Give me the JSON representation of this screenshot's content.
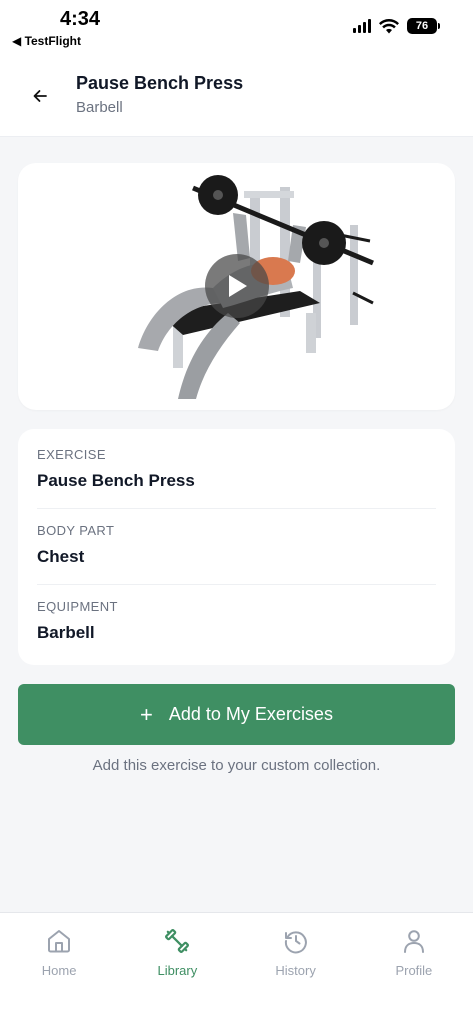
{
  "status_bar": {
    "time": "4:34",
    "back_app": "◀ TestFlight",
    "battery": "76"
  },
  "header": {
    "title": "Pause Bench Press",
    "subtitle": "Barbell"
  },
  "details": [
    {
      "label": "EXERCISE",
      "value": "Pause Bench Press"
    },
    {
      "label": "BODY PART",
      "value": "Chest"
    },
    {
      "label": "EQUIPMENT",
      "value": "Barbell"
    }
  ],
  "add_button": {
    "plus": "+",
    "label": "Add to My Exercises"
  },
  "helper_text": "Add this exercise to your custom collection.",
  "tabs": [
    {
      "label": "Home",
      "icon": "home-icon",
      "active": false
    },
    {
      "label": "Library",
      "icon": "dumbbell-icon",
      "active": true
    },
    {
      "label": "History",
      "icon": "history-icon",
      "active": false
    },
    {
      "label": "Profile",
      "icon": "profile-icon",
      "active": false
    }
  ],
  "colors": {
    "accent": "#3f8f63",
    "background": "#f5f6f8",
    "text_primary": "#111827",
    "text_secondary": "#6b7280",
    "tab_inactive": "#9ca3af"
  }
}
